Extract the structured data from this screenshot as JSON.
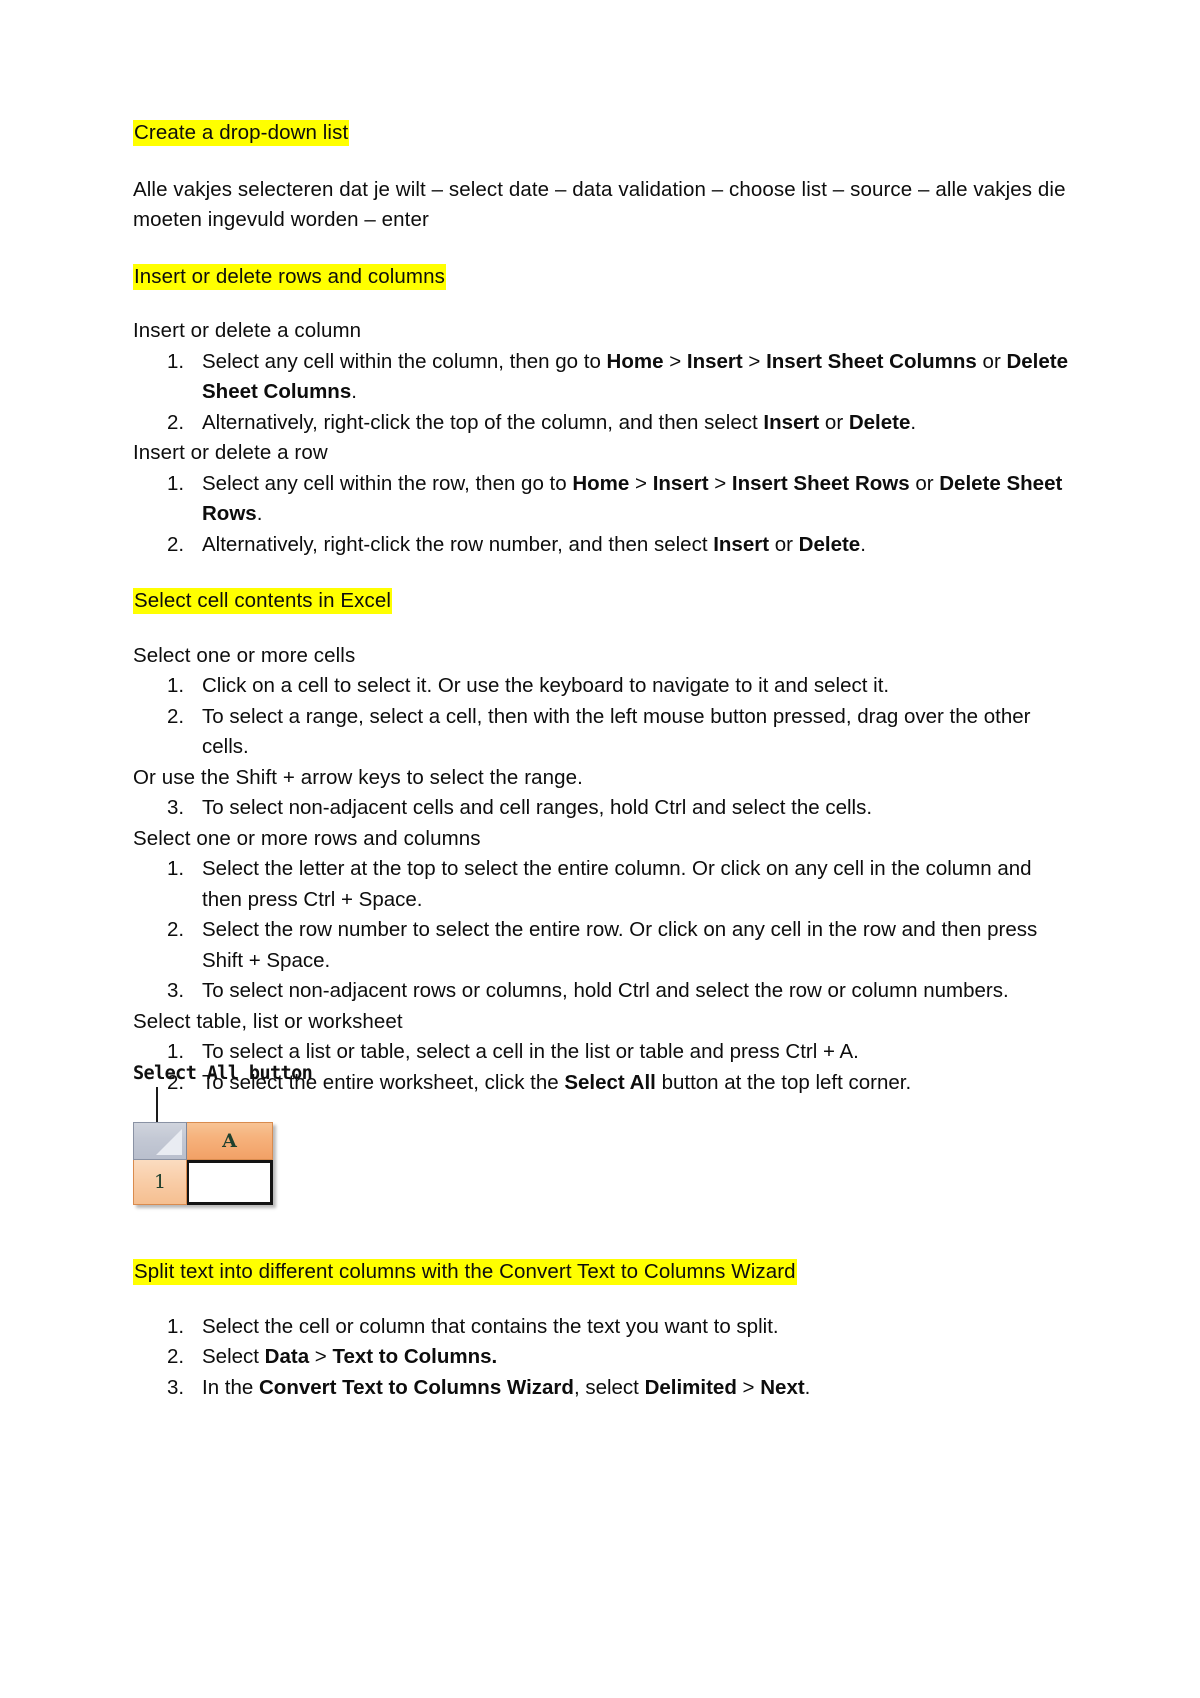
{
  "document": {
    "sections": [
      {
        "id": "create-dropdown",
        "heading": "Create a drop-down list",
        "paragraph": "Alle vakjes selecteren dat je wilt – select date – data validation – choose list – source – alle vakjes die moeten ingevuld worden – enter"
      },
      {
        "id": "insert-delete",
        "heading": "Insert or delete rows and columns",
        "sub1": "Insert or delete a column",
        "sub2": "Insert or delete a row",
        "col_items": [
          {
            "num": "1.",
            "text": "Select any cell within the column, then go to Home > Insert > Insert Sheet Columns or Delete Sheet Columns."
          },
          {
            "num": "2.",
            "text": "Alternatively, right-click the top of the column, and then select Insert or Delete."
          }
        ],
        "row_items": [
          {
            "num": "1.",
            "text": "Select any cell within the row, then go to Home > Insert > Insert Sheet Rows or Delete Sheet Rows."
          },
          {
            "num": "2.",
            "text": "Alternatively, right-click the row number, and then select Insert or Delete."
          }
        ]
      },
      {
        "id": "select-cell-contents",
        "heading": "Select cell contents in Excel",
        "sub1": "Select one or more cells",
        "cells_items": [
          {
            "num": "1.",
            "text": "Click on a cell to select it. Or use the keyboard to navigate to it and select it."
          },
          {
            "num": "2.",
            "text": "To select a range, select a cell, then with the left mouse button pressed, drag over the other cells."
          }
        ],
        "shift_note": "Or use the Shift + arrow keys to select the range.",
        "cells_item3": {
          "num": "3.",
          "text": "To select non-adjacent cells and cell ranges, hold Ctrl and select the cells."
        },
        "sub2": "Select one or more rows and columns",
        "rowscols_items": [
          {
            "num": "1.",
            "text": "Select the letter at the top to select the entire column. Or click on any cell in the column and then press Ctrl + Space."
          },
          {
            "num": "2.",
            "text": "Select the row number to select the entire row. Or click on any cell in the row and then press Shift + Space."
          },
          {
            "num": "3.",
            "text": "To select non-adjacent rows or columns, hold Ctrl and select the row or column numbers."
          }
        ],
        "sub3": "Select table, list or worksheet",
        "table_items": [
          {
            "num": "1.",
            "text": "To select a list or table, select a cell in the list or table and press Ctrl + A."
          },
          {
            "num": "2.",
            "text": "To select the entire worksheet, click the Select All button at the top left corner."
          }
        ]
      },
      {
        "id": "split-text",
        "heading": "Split text into different columns with the Convert Text to Columns Wizard",
        "items": [
          {
            "num": "1.",
            "text": "Select the cell or column that contains the text you want to split."
          },
          {
            "num": "2.",
            "text": "Select Data > Text to Columns."
          },
          {
            "num": "3.",
            "text": "In the Convert Text to Columns Wizard, select Delimited > Next."
          }
        ]
      }
    ]
  },
  "callout": {
    "label": "Select All button",
    "excel": {
      "select_all_icon": "select-all-triangle-icon",
      "column_header": "A",
      "row_header": "1",
      "active_cell_value": ""
    }
  },
  "colors": {
    "highlight": "#ffff00",
    "text": "#0d0d0d",
    "excel_header_orange": "#f2a167",
    "excel_row_orange": "#f8cba4",
    "select_all_gray": "#c3c8d4",
    "active_cell_border": "#131313"
  }
}
